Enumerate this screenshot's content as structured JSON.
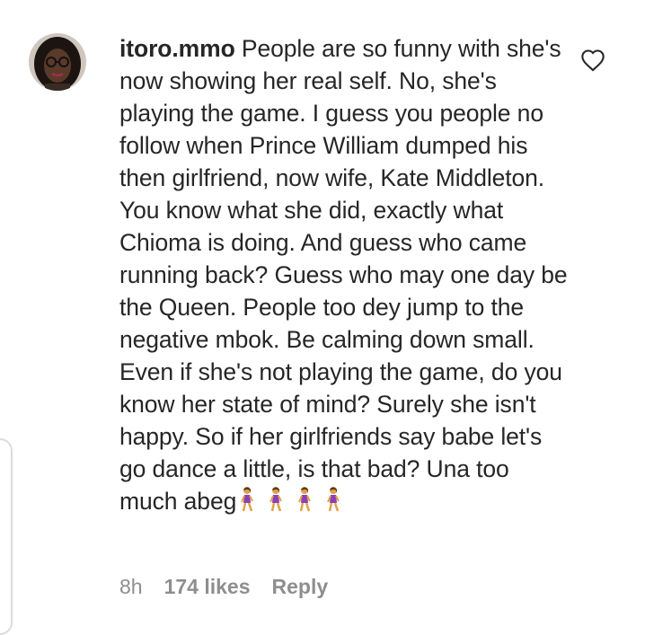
{
  "comment": {
    "username": "itoro.mmo",
    "text": "People are so funny with she's now showing her real self. No, she's playing the game. I guess you people no follow when Prince William dumped his then girlfriend, now wife, Kate Middleton. You know what she did, exactly what Chioma is doing. And guess who came running back? Guess who may one day be the Queen. People too dey jump to the negative mbok. Be calming down small. Even if she's not playing the game, do you know her state of mind? Surely she isn't happy. So if her girlfriends say babe let's go dance a little, is that bad? Una too much abeg",
    "emojis": [
      "woman-walking-emoji",
      "woman-walking-emoji",
      "woman-walking-emoji",
      "woman-walking-emoji"
    ],
    "timestamp": "8h",
    "likes": "174 likes",
    "reply_label": "Reply"
  },
  "icons": {
    "like": "heart-outline-icon",
    "avatar": "user-avatar"
  },
  "colors": {
    "text": "#262626",
    "meta": "#8e8e8e"
  }
}
